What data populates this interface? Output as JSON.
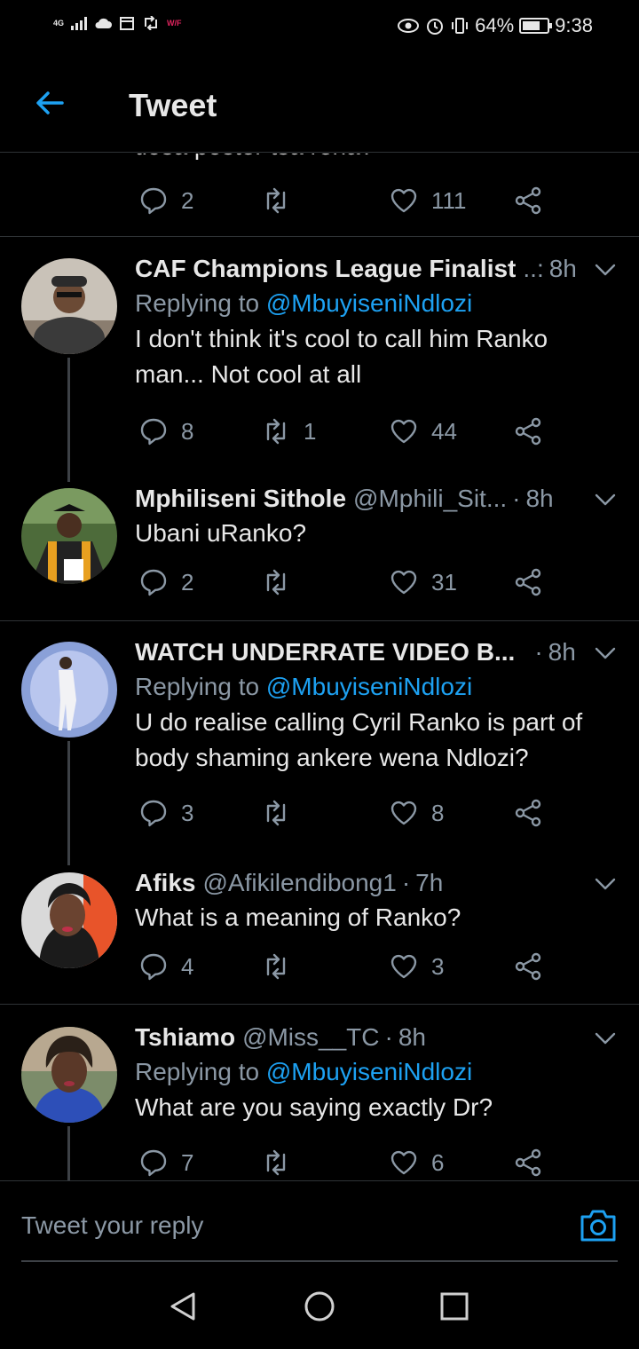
{
  "status_bar": {
    "network": "4G",
    "battery_percent": "64%",
    "time": "9:38",
    "wifi_label": "W/F"
  },
  "header": {
    "title": "Tweet"
  },
  "top_partial": {
    "cut_text": "tlosa poster tsa rena?",
    "replies": "2",
    "retweets": "",
    "likes": "111"
  },
  "tweets": [
    {
      "name": "CAF Champions League Finalist",
      "handle": "..:",
      "time": "8h",
      "replying_prefix": "Replying to",
      "replying_to": "@MbuyiseniNdlozi",
      "text_line1": "I don't think it's cool to call him Ranko",
      "text_line2": "man... Not cool at all",
      "replies": "8",
      "retweets": "1",
      "likes": "44"
    },
    {
      "name": "Mphiliseni Sithole",
      "handle": "@Mphili_Sit...",
      "time": "8h",
      "text_line1": "Ubani uRanko?",
      "replies": "2",
      "retweets": "",
      "likes": "31"
    },
    {
      "name": "WATCH UNDERRATE VIDEO B...",
      "handle": "",
      "time": "8h",
      "replying_prefix": "Replying to",
      "replying_to": "@MbuyiseniNdlozi",
      "text_line1": "U do realise calling Cyril Ranko is part of",
      "text_line2": "body shaming ankere wena Ndlozi?",
      "replies": "3",
      "retweets": "",
      "likes": "8"
    },
    {
      "name": "Afiks",
      "handle": "@Afikilendibong1",
      "time": "7h",
      "text_line1": "What is a meaning of Ranko?",
      "replies": "4",
      "retweets": "",
      "likes": "3"
    },
    {
      "name": "Tshiamo",
      "handle": "@Miss__TC",
      "time": "8h",
      "replying_prefix": "Replying to",
      "replying_to": "@MbuyiseniNdlozi",
      "text_line1": "What are you saying exactly Dr?",
      "replies": "7",
      "retweets": "",
      "likes": "6"
    }
  ],
  "reply_bar": {
    "placeholder": "Tweet your reply"
  },
  "colors": {
    "accent": "#1da1f2",
    "background": "#000000",
    "muted": "#8b98a5",
    "divider": "#2f3336"
  }
}
